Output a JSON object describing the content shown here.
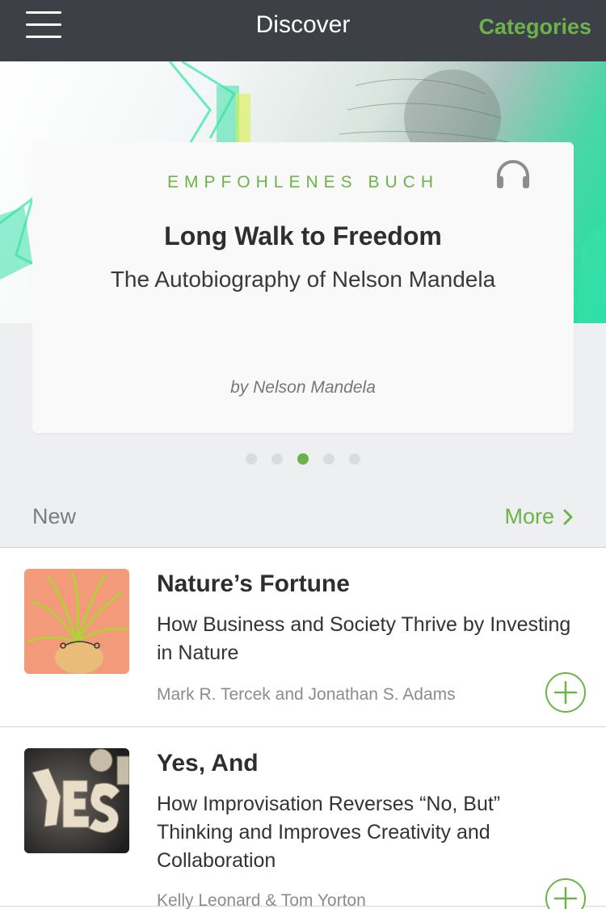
{
  "topbar": {
    "title": "Discover",
    "categories_label": "Categories",
    "menu_icon": "hamburger-menu-icon"
  },
  "featured": {
    "label": "EMPFOHLENES BUCH",
    "title": "Long Walk to Freedom",
    "subtitle": "The Autobiography of Nelson Mandela",
    "author": "by Nelson Mandela",
    "icon": "headphones-icon"
  },
  "pagination": {
    "count": 5,
    "active_index": 2
  },
  "section": {
    "title": "New",
    "more_label": "More",
    "more_icon": "chevron-right-icon"
  },
  "books": [
    {
      "title": "Nature’s Fortune",
      "subtitle": "How Business and Society Thrive by Investing in Nature",
      "author": "Mark R. Tercek and Jonathan S. Adams",
      "cover_icon": "plant-cover-image",
      "add_icon": "plus-circle-icon"
    },
    {
      "title": "Yes, And",
      "subtitle": "How Improvisation Reverses “No, But” Thinking and Improves Creativity and Collaboration",
      "author": "Kelly Leonard & Tom Yorton",
      "cover_icon": "yes-letters-cover-image",
      "add_icon": "plus-circle-icon"
    }
  ],
  "colors": {
    "accent": "#6cb34a",
    "topbar": "#3d4147",
    "background": "#eeeff1"
  }
}
